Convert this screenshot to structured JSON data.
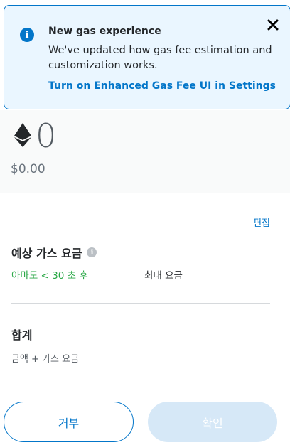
{
  "banner": {
    "title": "New gas experience",
    "body": "We've updated how gas fee estimation and customization works.",
    "link": "Turn on Enhanced Gas Fee UI in Settings",
    "info_icon": "i",
    "close_icon": "close-icon"
  },
  "amount": {
    "eth": "0",
    "fiat": "$0.00",
    "icon": "ethereum-icon"
  },
  "edit_label": "편집",
  "gas": {
    "title": "예상 가스 요금",
    "help_icon": "i",
    "timing": "아마도 < 30 초 후",
    "max_label": "최대 요금"
  },
  "total": {
    "title": "합계",
    "subtitle": "금액 + 가스 요금"
  },
  "buttons": {
    "reject": "거부",
    "confirm": "확인"
  },
  "colors": {
    "primary": "#0376c9",
    "banner_bg": "#eaf6ff",
    "success": "#28a745",
    "disabled_btn": "#d6e8f7"
  }
}
